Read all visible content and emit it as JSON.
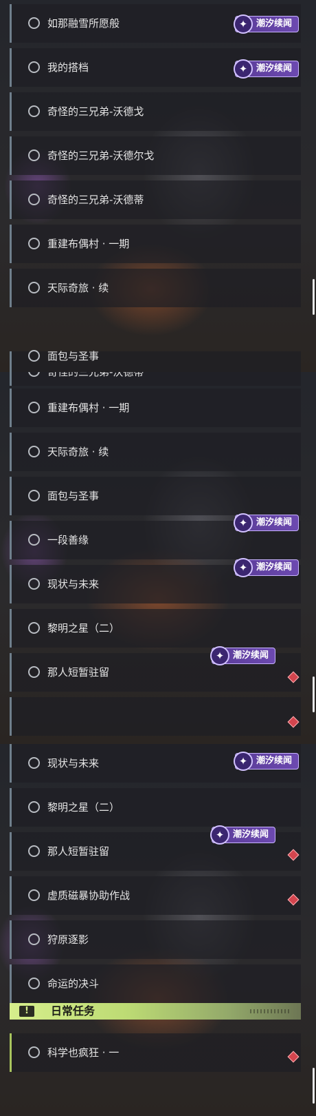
{
  "badge_text": "潮汐续闻",
  "icons": {
    "quest_circle": "circle-outline-icon",
    "badge": "sparkle-icon",
    "alert": "exclamation-icon",
    "marker": "diamond-marker-icon"
  },
  "colors": {
    "badge_bg": "#5a3c98",
    "diamond": "#d3454e",
    "header_bg": "#d6ee8c",
    "item_border": "#6f7f8c"
  },
  "panel1": {
    "quests": [
      {
        "label": "如那融雪所愿般",
        "badge": true
      },
      {
        "label": "我的搭档",
        "badge": true
      },
      {
        "label": "奇怪的三兄弟-沃德戈"
      },
      {
        "label": "奇怪的三兄弟-沃德尔戈"
      },
      {
        "label": "奇怪的三兄弟-沃德蒂"
      },
      {
        "label": "重建布偶村 · 一期"
      },
      {
        "label": "天际奇旅 · 续"
      },
      {
        "label": "面包与圣事"
      }
    ]
  },
  "panel2": {
    "quests": [
      {
        "label": "奇怪的三兄弟-沃德蒂"
      },
      {
        "label": "重建布偶村 · 一期"
      },
      {
        "label": "天际奇旅 · 续"
      },
      {
        "label": "面包与圣事"
      },
      {
        "label": "一段善缘",
        "badge": true
      },
      {
        "label": "现状与未来",
        "badge": true
      },
      {
        "label": "黎明之星（二）"
      },
      {
        "label": "那人短暂驻留",
        "badge": true,
        "marker": true
      },
      {
        "label": "",
        "marker": true
      }
    ]
  },
  "panel3": {
    "quests": [
      {
        "label": "现状与未来",
        "badge": true
      },
      {
        "label": "黎明之星（二）"
      },
      {
        "label": "那人短暂驻留",
        "badge": true,
        "marker": true
      },
      {
        "label": "虚质磁暴协助作战",
        "marker": true
      },
      {
        "label": "狩原逐影"
      },
      {
        "label": "命运的决斗"
      }
    ],
    "section_title": "日常任务",
    "daily_quests": [
      {
        "label": "科学也疯狂 · 一",
        "marker": true
      }
    ]
  }
}
